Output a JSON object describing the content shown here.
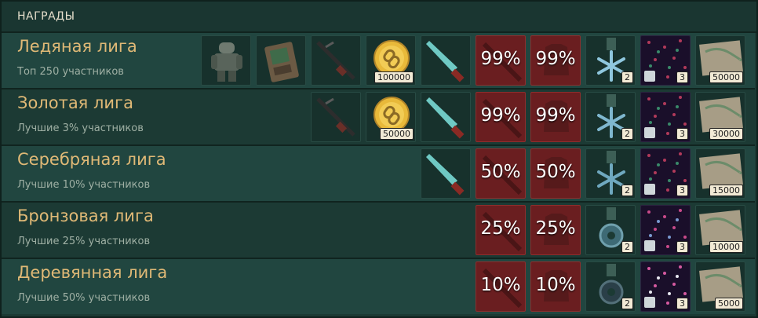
{
  "header": {
    "title": "НАГРАДЫ"
  },
  "leagues": [
    {
      "name": "Ледяная лига",
      "desc": "Топ 250 участников",
      "coin": "100000",
      "pct_weapon": "99%",
      "pct_armor": "99%",
      "medal": "2",
      "pattern": "3",
      "map": "50000"
    },
    {
      "name": "Золотая лига",
      "desc": "Лучшие 3% участников",
      "coin": "50000",
      "pct_weapon": "99%",
      "pct_armor": "99%",
      "medal": "2",
      "pattern": "3",
      "map": "30000"
    },
    {
      "name": "Серебряная лига",
      "desc": "Лучшие 10% участников",
      "pct_weapon": "50%",
      "pct_armor": "50%",
      "medal": "2",
      "pattern": "3",
      "map": "15000"
    },
    {
      "name": "Бронзовая лига",
      "desc": "Лучшие 25% участников",
      "pct_weapon": "25%",
      "pct_armor": "25%",
      "medal": "2",
      "pattern": "3",
      "map": "10000"
    },
    {
      "name": "Деревянная лига",
      "desc": "Лучшие 50% участников",
      "pct_weapon": "10%",
      "pct_armor": "10%",
      "medal": "2",
      "pattern": "3",
      "map": "5000"
    }
  ]
}
